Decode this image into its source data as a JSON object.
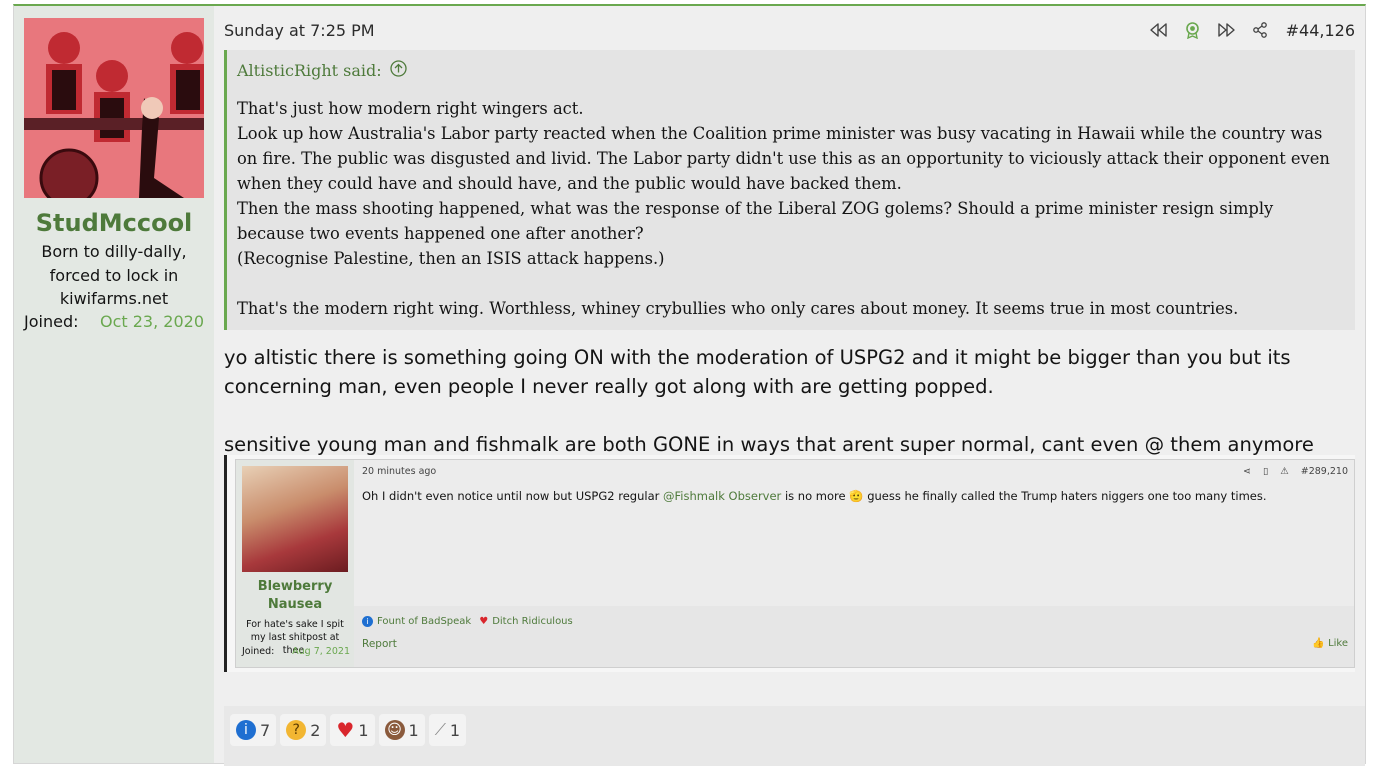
{
  "post": {
    "date": "Sunday at 7:25 PM",
    "post_number": "#44,126",
    "author": {
      "name": "StudMccool",
      "title": "Born to dilly-dally, forced to lock in kiwifarms.net",
      "joined_label": "Joined:",
      "joined_value": "Oct 23, 2020"
    },
    "quote": {
      "attribution": "AltisticRight said:",
      "lines": [
        "That's just how modern right wingers act.",
        "Look up how Australia's Labor party reacted when the Coalition prime minister was busy vacating in Hawaii while the country was on fire. The public was disgusted and livid. The Labor party didn't use this as an opportunity to viciously attack their opponent even when they could have and should have, and the public would have backed them.",
        "Then the mass shooting happened, what was the response of the Liberal ZOG golems? Should a prime minister resign simply because two events happened one after another?",
        "(Recognise Palestine, then an ISIS attack happens.)",
        "That's the modern right wing. Worthless, whiney crybullies who only cares about money. It seems true in most countries."
      ]
    },
    "body": {
      "p1": "yo altistic there is something going ON with the moderation of USPG2 and it might be bigger than you but its concerning man, even people I never really got along with are getting popped.",
      "p2": "sensitive young man and fishmalk are both GONE in ways that arent super normal, cant even @ them anymore"
    },
    "embed": {
      "time": "20 minutes ago",
      "post_number": "#289,210",
      "author_name": "Blewberry Nausea",
      "author_title": "For hate's sake I spit my last shitpost at thee.",
      "joined_label": "Joined:",
      "joined_value": "Aug 7, 2021",
      "text_before": "Oh I didn't even notice until now but USPG2 regular ",
      "mention": "@Fishmalk Observer",
      "text_after": " is no more 🫡 guess he finally called the Trump haters niggers one too many times.",
      "reactions": [
        {
          "label": "Fount of BadSpeak",
          "icon": "info-icon"
        },
        {
          "label": "Ditch Ridiculous",
          "icon": "heart-icon"
        }
      ],
      "report": "Report",
      "like": "Like"
    },
    "reactions": [
      {
        "icon": "info-icon",
        "count": "7",
        "color": "#1f6fd1"
      },
      {
        "icon": "thinking-icon",
        "count": "2",
        "color": "#f2b632"
      },
      {
        "icon": "heart-icon",
        "count": "1",
        "color": "#d9262c"
      },
      {
        "icon": "monkey-face-icon",
        "count": "1",
        "color": "#8a5a3c"
      },
      {
        "icon": "wrench-icon",
        "count": "1",
        "color": "#8a8a8a"
      }
    ]
  }
}
